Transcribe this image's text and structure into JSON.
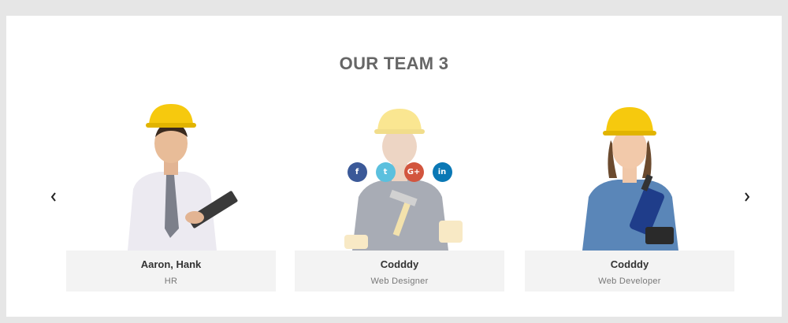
{
  "section": {
    "title": "OUR TEAM 3"
  },
  "carousel": {
    "prev_icon": "chevron-left-icon",
    "next_icon": "chevron-right-icon"
  },
  "team": [
    {
      "name": "Aaron, Hank",
      "role": "HR"
    },
    {
      "name": "Codddy",
      "role": "Web Designer"
    },
    {
      "name": "Codddy",
      "role": "Web Developer"
    }
  ],
  "social": {
    "facebook": "f",
    "twitter": "t",
    "google_plus": "G+",
    "linkedin": "in"
  },
  "colors": {
    "background": "#e6e6e6",
    "card_info_bg": "#f3f3f3",
    "helmet": "#f6c90e",
    "facebook": "#3b5998",
    "twitter": "#5bc0de",
    "google_plus": "#d2553e",
    "linkedin": "#0a78b5"
  }
}
